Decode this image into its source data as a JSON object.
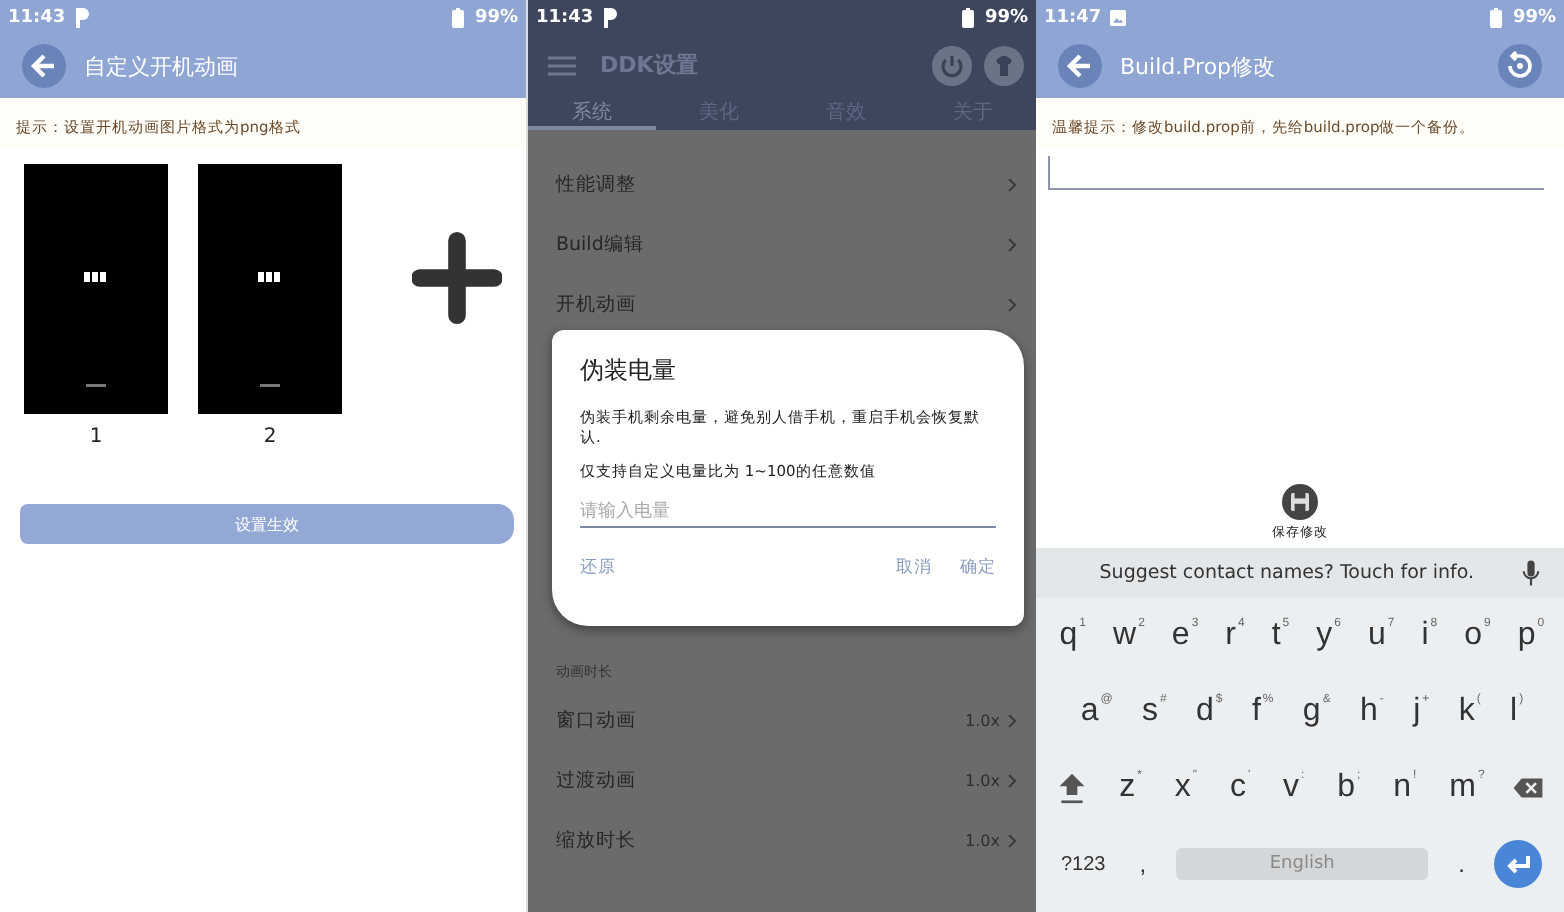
{
  "boot_animation_screen": {
    "status_bar": {
      "time": "11:43",
      "battery": "99%"
    },
    "title": "自定义开机动画",
    "hint": "提示：设置开机动画图片格式为png格式",
    "frames": [
      {
        "kind": "picture",
        "label": "1"
      },
      {
        "kind": "picture",
        "label": "2"
      }
    ],
    "apply_button": "设置生效"
  },
  "settings_screen": {
    "status_bar": {
      "time": "11:43",
      "battery": "99%"
    },
    "title": "DDK设置",
    "tabs": [
      {
        "label": "系统",
        "selected": true
      },
      {
        "label": "美化",
        "selected": false
      },
      {
        "label": "音效",
        "selected": false
      },
      {
        "label": "关于",
        "selected": false
      }
    ],
    "items_top": [
      {
        "label": "性能调整"
      },
      {
        "label": "Build编辑"
      },
      {
        "label": "开机动画"
      }
    ],
    "section": "动画时长",
    "items_bottom": [
      {
        "label": "窗口动画",
        "value": "1.0x"
      },
      {
        "label": "过渡动画",
        "value": "1.0x"
      },
      {
        "label": "缩放时长",
        "value": "1.0x"
      }
    ],
    "dialog": {
      "title": "伪装电量",
      "message": "伪装手机剩余电量，避免别人借手机，重启手机会恢复默认.",
      "note": "仅支持自定义电量比为 1~100的任意数值",
      "placeholder": "请输入电量",
      "buttons": [
        "还原",
        "取消",
        "确定"
      ]
    }
  },
  "build_prop_screen": {
    "status_bar": {
      "time": "11:47",
      "battery": "99%"
    },
    "title": "Build.Prop修改",
    "hint": "温馨提示：修改build.prop前，先给build.prop做一个备份。",
    "save_label": "保存修改",
    "keyboard": {
      "suggestion": "Suggest contact names? Touch for info.",
      "top_row": [
        {
          "kind": "letter",
          "label": "q",
          "hint": "1"
        },
        {
          "kind": "letter",
          "label": "w",
          "hint": "2"
        },
        {
          "kind": "letter",
          "label": "e",
          "hint": "3"
        },
        {
          "kind": "letter",
          "label": "r",
          "hint": "4"
        },
        {
          "kind": "letter",
          "label": "t",
          "hint": "5"
        },
        {
          "kind": "letter",
          "label": "y",
          "hint": "6"
        },
        {
          "kind": "letter",
          "label": "u",
          "hint": "7"
        },
        {
          "kind": "letter",
          "label": "i",
          "hint": "8"
        },
        {
          "kind": "letter",
          "label": "o",
          "hint": "9"
        },
        {
          "kind": "letter",
          "label": "p",
          "hint": "0"
        }
      ],
      "middle_row": [
        {
          "kind": "letter",
          "label": "a",
          "hint": "@"
        },
        {
          "kind": "letter",
          "label": "s",
          "hint": "#"
        },
        {
          "kind": "letter",
          "label": "d",
          "hint": "$"
        },
        {
          "kind": "letter",
          "label": "f",
          "hint": "%"
        },
        {
          "kind": "letter",
          "label": "g",
          "hint": "&"
        },
        {
          "kind": "letter",
          "label": "h",
          "hint": "-"
        },
        {
          "kind": "letter",
          "label": "j",
          "hint": "+"
        },
        {
          "kind": "letter",
          "label": "k",
          "hint": "("
        },
        {
          "kind": "letter",
          "label": "l",
          "hint": ")"
        }
      ],
      "lower_row": [
        {
          "kind": "shift"
        },
        {
          "kind": "letter",
          "label": "z",
          "hint": "*"
        },
        {
          "kind": "letter",
          "label": "x",
          "hint": "\""
        },
        {
          "kind": "letter",
          "label": "c",
          "hint": "'"
        },
        {
          "kind": "letter",
          "label": "v",
          "hint": ":"
        },
        {
          "kind": "letter",
          "label": "b",
          "hint": ";"
        },
        {
          "kind": "letter",
          "label": "n",
          "hint": "!"
        },
        {
          "kind": "letter",
          "label": "m",
          "hint": "?"
        },
        {
          "kind": "backspace"
        }
      ],
      "bottom_row": {
        "symbols": "?123",
        "comma": ",",
        "space": "English",
        "period": "."
      }
    }
  }
}
